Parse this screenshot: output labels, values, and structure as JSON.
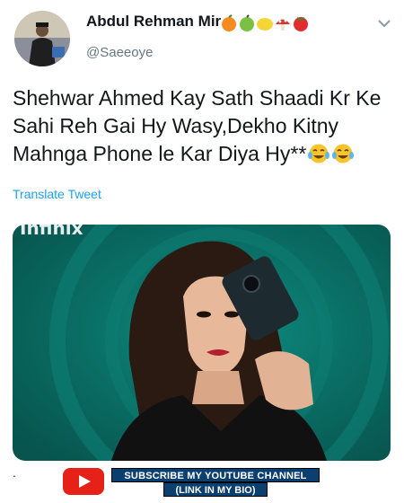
{
  "tweet": {
    "author": {
      "display_name": "Abdul Rehman Mir",
      "name_emojis": [
        "orange-emoji",
        "apple-emoji",
        "lemon-emoji",
        "mushroom-emoji",
        "tomato-emoji"
      ],
      "handle": "@Saeeoye"
    },
    "menu_icon": "chevron-down-icon",
    "text": "Shehwar Ahmed Kay Sath Shaadi Kr Ke Sahi Reh Gai Hy Wasy,Dekho Kitny Mahnga Phone le Kar Diya Hy**",
    "text_emojis": [
      "tears-of-joy-emoji",
      "tears-of-joy-emoji"
    ],
    "translate_label": "Translate Tweet",
    "media": {
      "brand_text": "Infinix",
      "description": "woman holding phone"
    }
  },
  "footer": {
    "dot": ".",
    "youtube_icon": "youtube-play-icon",
    "subscribe_line1": "SUBSCRIBE MY YOUTUBE CHANNEL",
    "subscribe_line2": "(LINK IN MY BIO)"
  },
  "colors": {
    "link_blue": "#1da1f2",
    "handle_gray": "#657786",
    "banner_navy": "#0b3f70",
    "youtube_red": "#e62117"
  }
}
